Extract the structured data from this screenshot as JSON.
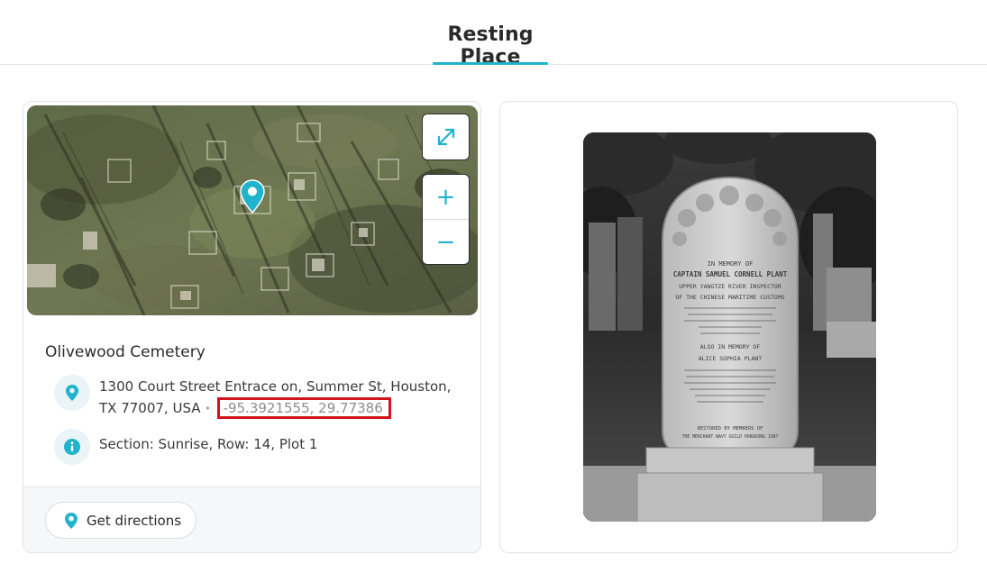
{
  "tabs": [
    {
      "label": "Resting Place",
      "active": true
    }
  ],
  "accent_color": "#1fb4cc",
  "map": {
    "fullscreen_icon": "expand-arrows-icon",
    "zoom_in_label": "+",
    "zoom_out_label": "−",
    "marker_icon": "map-pin-icon"
  },
  "cemetery": {
    "name": "Olivewood Cemetery",
    "address": "1300 Court Street Entrace on, Summer St, Houston, TX 77007, USA",
    "separator": "•",
    "coordinates": "-95.3921555, 29.77386",
    "plot": "Section: Sunrise, Row: 14, Plot 1"
  },
  "footer": {
    "directions_label": "Get directions"
  },
  "photo": {
    "headstone_lines": [
      "IN MEMORY OF",
      "CAPTAIN SAMUEL CORNELL PLANT",
      "UPPER YANGTZE RIVER INSPECTOR",
      "OF THE CHINESE MARITIME CUSTOMS",
      "ALSO IN MEMORY OF",
      "ALICE SOPHIA PLANT",
      "RESTORED BY MEMBERS OF",
      "THE MERCHANT NAVY GUILD HONGKONG 1987"
    ]
  }
}
